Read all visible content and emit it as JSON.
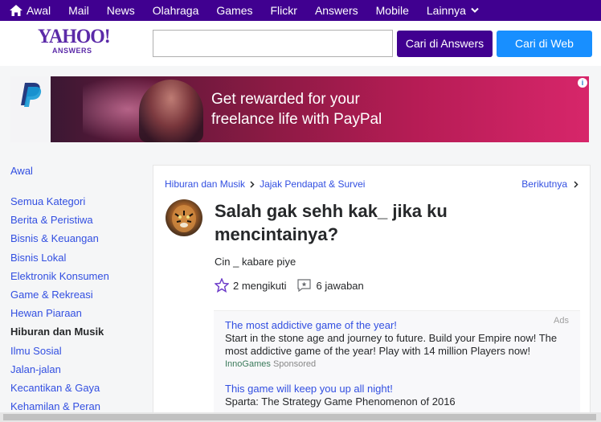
{
  "topnav": {
    "items": [
      "Awal",
      "Mail",
      "News",
      "Olahraga",
      "Games",
      "Flickr",
      "Answers",
      "Mobile",
      "Lainnya"
    ]
  },
  "header": {
    "logo_main": "YAHOO!",
    "logo_sub": "ANSWERS",
    "search_placeholder": "",
    "btn_answers": "Cari di Answers",
    "btn_web": "Cari di Web"
  },
  "banner": {
    "line1": "Get rewarded for your",
    "line2": "freelance life with PayPal"
  },
  "sidebar": {
    "home": "Awal",
    "categories": [
      "Semua Kategori",
      "Berita & Peristiwa",
      "Bisnis & Keuangan",
      "Bisnis Lokal",
      "Elektronik Konsumen",
      "Game & Rekreasi",
      "Hewan Piaraan",
      "Hiburan dan Musik",
      "Ilmu Sosial",
      "Jalan-jalan",
      "Kecantikan & Gaya",
      "Kehamilan & Peran"
    ],
    "active": "Hiburan dan Musik"
  },
  "main": {
    "crumb1": "Hiburan dan Musik",
    "crumb2": "Jajak Pendapat & Survei",
    "next": "Berikutnya",
    "question": "Salah gak sehh kak_ jika ku mencintainya?",
    "description": "Cin _ kabare piye",
    "followers": "2 mengikuti",
    "answers": "6 jawaban"
  },
  "ads": {
    "label": "Ads",
    "ad1": {
      "title": "The most addictive game of the year!",
      "body": "Start in the stone age and journey to future. Build your Empire now! The most addictive game of the year! Play with 14 million Players now!",
      "brand": "InnoGames",
      "sponsored": "Sponsored"
    },
    "ad2": {
      "title": "This game will keep you up all night!",
      "body": "Sparta: The Strategy Game Phenomenon of 2016"
    }
  },
  "colors": {
    "nav_purple": "#400090",
    "btn_blue": "#188fff",
    "link_blue": "#324fe1"
  }
}
